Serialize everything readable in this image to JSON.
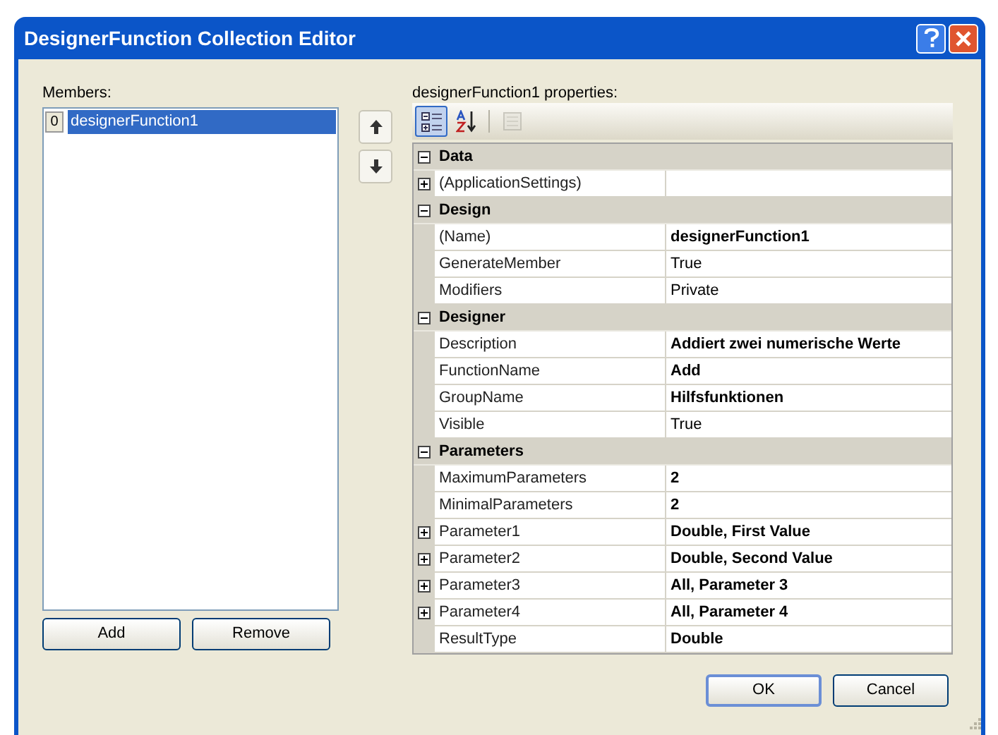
{
  "window": {
    "title": "DesignerFunction Collection Editor"
  },
  "members": {
    "label": "Members:",
    "items": [
      {
        "index": "0",
        "name": "designerFunction1",
        "selected": true
      }
    ]
  },
  "member_buttons": [
    "Add",
    "Remove"
  ],
  "properties": {
    "label": "designerFunction1 properties:",
    "toolbar": [
      {
        "kind": "categorized",
        "selected": true,
        "disabled": false
      },
      {
        "kind": "alphabetical",
        "selected": false,
        "disabled": false
      },
      {
        "kind": "property-pages",
        "selected": false,
        "disabled": true
      }
    ],
    "categories": [
      {
        "name": "Data",
        "expanded": true,
        "properties": [
          {
            "name": "(ApplicationSettings)",
            "modified": false,
            "kind": "expandable",
            "expanded": false
          }
        ]
      },
      {
        "name": "Design",
        "expanded": true,
        "properties": [
          {
            "name": "(Name)",
            "value": "designerFunction1",
            "modified": true,
            "kind": "plain"
          },
          {
            "name": "GenerateMember",
            "value": "True",
            "modified": false,
            "kind": "plain"
          },
          {
            "name": "Modifiers",
            "value": "Private",
            "modified": false,
            "kind": "plain"
          }
        ]
      },
      {
        "name": "Designer",
        "expanded": true,
        "properties": [
          {
            "name": "Description",
            "value": "Addiert zwei numerische Werte",
            "modified": true,
            "kind": "plain"
          },
          {
            "name": "FunctionName",
            "value": "Add",
            "modified": true,
            "kind": "plain"
          },
          {
            "name": "GroupName",
            "value": "Hilfsfunktionen",
            "modified": true,
            "kind": "plain"
          },
          {
            "name": "Visible",
            "value": "True",
            "modified": false,
            "kind": "plain"
          }
        ]
      },
      {
        "name": "Parameters",
        "expanded": true,
        "properties": [
          {
            "name": "MaximumParameters",
            "value": "2",
            "modified": true,
            "kind": "plain"
          },
          {
            "name": "MinimalParameters",
            "value": "2",
            "modified": true,
            "kind": "plain"
          },
          {
            "name": "Parameter1",
            "value": "Double, First Value",
            "modified": true,
            "kind": "expandable",
            "expanded": false
          },
          {
            "name": "Parameter2",
            "value": "Double, Second Value",
            "modified": true,
            "kind": "expandable",
            "expanded": false
          },
          {
            "name": "Parameter3",
            "value": "All, Parameter 3",
            "modified": true,
            "kind": "expandable",
            "expanded": false
          },
          {
            "name": "Parameter4",
            "value": "All, Parameter 4",
            "modified": true,
            "kind": "expandable",
            "expanded": false
          },
          {
            "name": "ResultType",
            "value": "Double",
            "modified": true,
            "kind": "plain"
          }
        ]
      }
    ]
  },
  "dialog_buttons": [
    "OK",
    "Cancel"
  ]
}
